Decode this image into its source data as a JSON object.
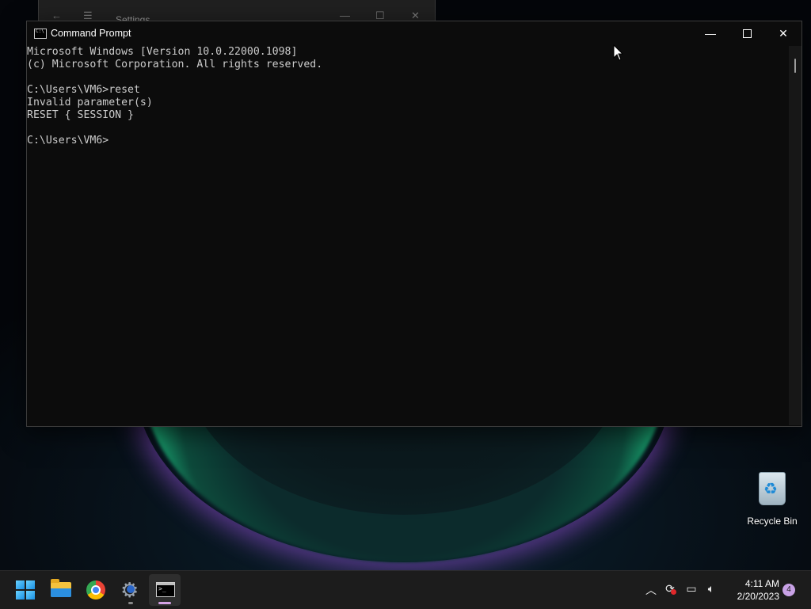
{
  "settings_window": {
    "title": "Settings"
  },
  "cmd_window": {
    "title": "Command Prompt",
    "lines": [
      "Microsoft Windows [Version 10.0.22000.1098]",
      "(c) Microsoft Corporation. All rights reserved.",
      "",
      "C:\\Users\\VM6>reset",
      "Invalid parameter(s)",
      "RESET { SESSION }",
      "",
      "C:\\Users\\VM6>"
    ]
  },
  "desktop": {
    "recycle_bin_label": "Recycle Bin"
  },
  "taskbar": {
    "apps": [
      {
        "name": "start-button",
        "icon": "windows-logo-icon"
      },
      {
        "name": "file-explorer",
        "icon": "folder-icon"
      },
      {
        "name": "google-chrome",
        "icon": "chrome-icon"
      },
      {
        "name": "settings",
        "icon": "gear-icon"
      },
      {
        "name": "command-prompt",
        "icon": "terminal-icon",
        "active": true
      }
    ],
    "clock_time": "4:11 AM",
    "clock_date": "2/20/2023",
    "notification_count": "4"
  },
  "colors": {
    "console_text": "#cccccc",
    "console_bg": "#0c0c0c",
    "taskbar_bg": "#1c1c1c",
    "active_indicator": "#d5a2e6"
  }
}
